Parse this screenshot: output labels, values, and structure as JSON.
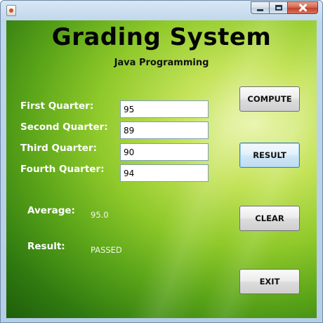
{
  "window": {
    "title": ""
  },
  "header": {
    "title": "Grading System",
    "subtitle": "Java Programming"
  },
  "form": {
    "first_label": "First Quarter:",
    "first_value": "95",
    "second_label": "Second Quarter:",
    "second_value": "89",
    "third_label": "Third Quarter:",
    "third_value": "90",
    "fourth_label": "Fourth Quarter:",
    "fourth_value": "94"
  },
  "output": {
    "average_label": "Average:",
    "average_value": "95.0",
    "result_label": "Result:",
    "result_value": "PASSED"
  },
  "buttons": {
    "compute": "COMPUTE",
    "result": "RESULT",
    "clear": "CLEAR",
    "exit": "EXIT"
  },
  "colors": {
    "background_green": "#8fc92a",
    "label_text": "#ffffff",
    "title_text": "#050505"
  }
}
